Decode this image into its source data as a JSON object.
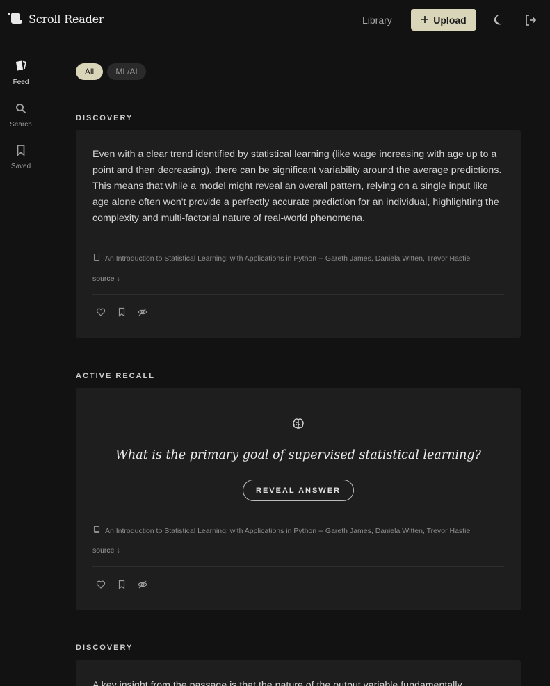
{
  "header": {
    "brand": "Scroll Reader",
    "nav_library": "Library",
    "upload_label": "Upload"
  },
  "sidebar": {
    "items": [
      {
        "label": "Feed",
        "icon": "cards-icon"
      },
      {
        "label": "Search",
        "icon": "search-icon"
      },
      {
        "label": "Saved",
        "icon": "bookmark-icon"
      }
    ]
  },
  "filters": [
    "All",
    "ML/AI"
  ],
  "cards": [
    {
      "section": "DISCOVERY",
      "text": "Even with a clear trend identified by statistical learning (like wage increasing with age up to a point and then decreasing), there can be significant variability around the average predictions. This means that while a model might reveal an overall pattern, relying on a single input like age alone often won't provide a perfectly accurate prediction for an individual, highlighting the complexity and multi-factorial nature of real-world phenomena.",
      "citation": "An Introduction to Statistical Learning: with Applications in Python -- Gareth James, Daniela Witten, Trevor Hastie",
      "source_label": "source ↓"
    },
    {
      "section": "ACTIVE RECALL",
      "question": "What is the primary goal of supervised statistical learning?",
      "reveal_label": "REVEAL ANSWER",
      "citation": "An Introduction to Statistical Learning: with Applications in Python -- Gareth James, Daniela Witten, Trevor Hastie",
      "source_label": "source ↓"
    },
    {
      "section": "DISCOVERY",
      "text": "A key insight from the passage is that the nature of the output variable fundamentally"
    }
  ],
  "colors": {
    "accent": "#d9d5b9",
    "background": "#121212",
    "card": "#1e1e1e"
  }
}
